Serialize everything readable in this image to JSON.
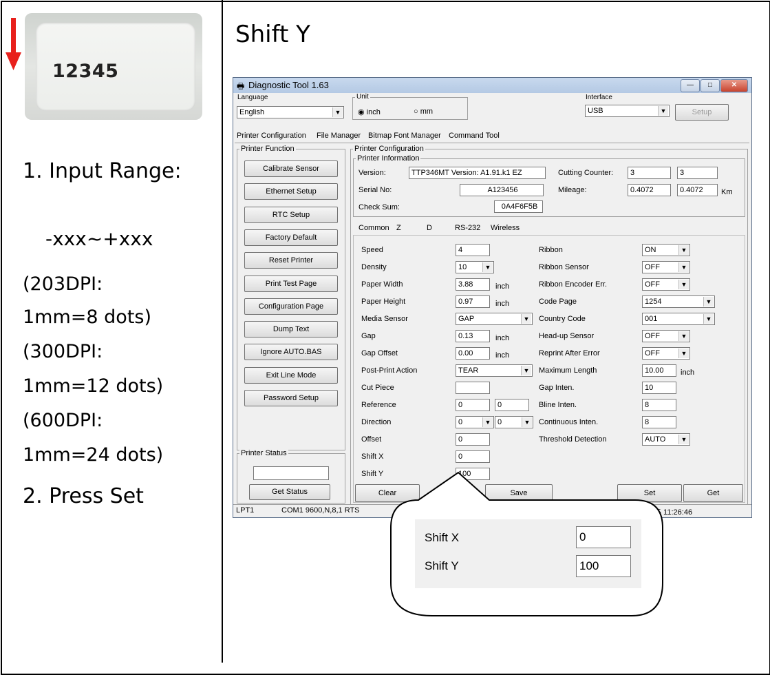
{
  "left": {
    "label_number": "12345",
    "step1": "1. Input Range:",
    "range": "-xxx~+xxx",
    "dpi_lines": [
      "(203DPI:",
      "1mm=8 dots)",
      "(300DPI:",
      "1mm=12 dots)",
      "(600DPI:",
      "1mm=24 dots)"
    ],
    "step2": "2. Press Set"
  },
  "right_title": "Shift Y",
  "window": {
    "title": "Diagnostic Tool 1.63",
    "language": {
      "label": "Language",
      "value": "English"
    },
    "unit": {
      "label": "Unit",
      "inch": "inch",
      "mm": "mm",
      "selected": "inch"
    },
    "interface": {
      "label": "Interface",
      "value": "USB",
      "setup": "Setup"
    },
    "tabs": [
      "Printer Configuration",
      "File Manager",
      "Bitmap Font Manager",
      "Command Tool"
    ],
    "printer_function": {
      "label": "Printer Function",
      "buttons": [
        "Calibrate Sensor",
        "Ethernet Setup",
        "RTC Setup",
        "Factory Default",
        "Reset Printer",
        "Print Test Page",
        "Configuration Page",
        "Dump Text",
        "Ignore AUTO.BAS",
        "Exit Line Mode",
        "Password Setup"
      ]
    },
    "printer_status": {
      "label": "Printer Status",
      "get_status": "Get Status"
    },
    "config": {
      "label": "Printer Configuration",
      "info_label": "Printer Information",
      "version_label": "Version:",
      "version": "TTP346MT Version: A1.91.k1 EZ",
      "serial_label": "Serial No:",
      "serial": "A123456",
      "checksum_label": "Check Sum:",
      "checksum": "0A4F6F5B",
      "cutting_label": "Cutting Counter:",
      "cutting1": "3",
      "cutting2": "3",
      "mileage_label": "Mileage:",
      "mileage1": "0.4072",
      "mileage2": "0.4072",
      "mileage_unit": "Km"
    },
    "subtabs": [
      "Common",
      "Z",
      "D",
      "RS-232",
      "Wireless"
    ],
    "common": {
      "speed": {
        "label": "Speed",
        "value": "4"
      },
      "density": {
        "label": "Density",
        "value": "10"
      },
      "paper_width": {
        "label": "Paper Width",
        "value": "3.88",
        "unit": "inch"
      },
      "paper_height": {
        "label": "Paper Height",
        "value": "0.97",
        "unit": "inch"
      },
      "media_sensor": {
        "label": "Media Sensor",
        "value": "GAP"
      },
      "gap": {
        "label": "Gap",
        "value": "0.13",
        "unit": "inch"
      },
      "gap_offset": {
        "label": "Gap Offset",
        "value": "0.00",
        "unit": "inch"
      },
      "post_print": {
        "label": "Post-Print Action",
        "value": "TEAR"
      },
      "cut_piece": {
        "label": "Cut Piece",
        "value": ""
      },
      "reference": {
        "label": "Reference",
        "value1": "0",
        "value2": "0"
      },
      "direction": {
        "label": "Direction",
        "value1": "0",
        "value2": "0"
      },
      "offset": {
        "label": "Offset",
        "value": "0"
      },
      "shift_x": {
        "label": "Shift X",
        "value": "0"
      },
      "shift_y": {
        "label": "Shift Y",
        "value": "100"
      },
      "ribbon": {
        "label": "Ribbon",
        "value": "ON"
      },
      "ribbon_sensor": {
        "label": "Ribbon Sensor",
        "value": "OFF"
      },
      "ribbon_encoder": {
        "label": "Ribbon Encoder Err.",
        "value": "OFF"
      },
      "code_page": {
        "label": "Code Page",
        "value": "1254"
      },
      "country_code": {
        "label": "Country Code",
        "value": "001"
      },
      "headup": {
        "label": "Head-up Sensor",
        "value": "OFF"
      },
      "reprint": {
        "label": "Reprint After Error",
        "value": "OFF"
      },
      "max_length": {
        "label": "Maximum Length",
        "value": "10.00",
        "unit": "inch"
      },
      "gap_inten": {
        "label": "Gap Inten.",
        "value": "10"
      },
      "bline_inten": {
        "label": "Bline Inten.",
        "value": "8"
      },
      "cont_inten": {
        "label": "Continuous Inten.",
        "value": "8"
      },
      "threshold": {
        "label": "Threshold Detection",
        "value": "AUTO"
      }
    },
    "bottom_buttons": {
      "clear": "Clear",
      "save": "Save",
      "set": "Set",
      "get": "Get"
    },
    "statusbar": {
      "port1": "LPT1",
      "port2": "COM1 9600,N,8,1 RTS",
      "time": "上午 11:26:46"
    }
  },
  "zoom": {
    "shift_x_label": "Shift X",
    "shift_x": "0",
    "shift_y_label": "Shift Y",
    "shift_y": "100"
  },
  "colors": {
    "arrow": "#e8201c",
    "window_border": "#5a6e8a"
  }
}
